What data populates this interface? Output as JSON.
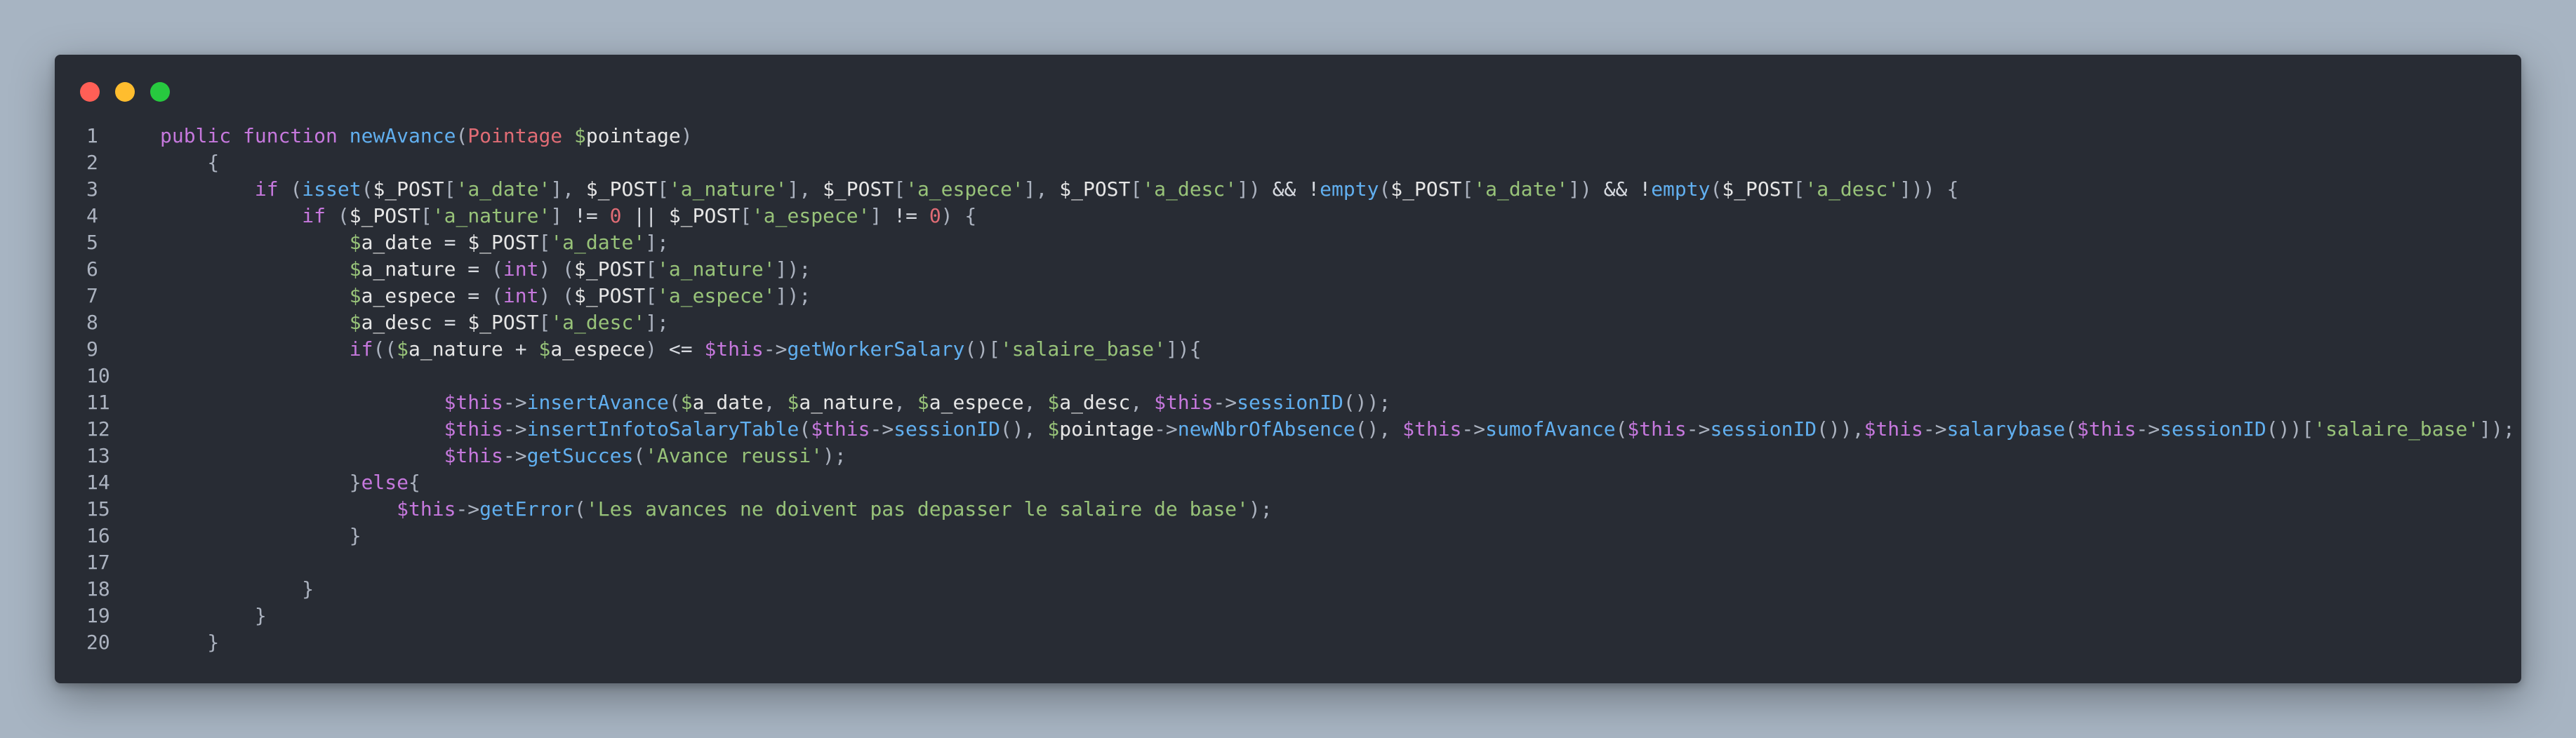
{
  "window": {
    "traffic_lights": [
      "close",
      "minimize",
      "maximize"
    ],
    "colors": {
      "background": "#a7b4c2",
      "window": "#282c34",
      "close": "#ff5f56",
      "minimize": "#ffbd2e",
      "maximize": "#27c93f"
    }
  },
  "code": {
    "language": "php",
    "lines": [
      {
        "n": "1",
        "tokens": [
          {
            "t": "kw",
            "v": "public function "
          },
          {
            "t": "fn",
            "v": "newAvance"
          },
          {
            "t": "punc",
            "v": "("
          },
          {
            "t": "cls",
            "v": "Pointage "
          },
          {
            "t": "dollar",
            "v": "$"
          },
          {
            "t": "var",
            "v": "pointage"
          },
          {
            "t": "punc",
            "v": ")"
          }
        ]
      },
      {
        "n": "2",
        "tokens": [
          {
            "t": "punc",
            "v": "    {"
          }
        ]
      },
      {
        "n": "3",
        "tokens": [
          {
            "t": "kw",
            "v": "        if "
          },
          {
            "t": "punc",
            "v": "("
          },
          {
            "t": "fn",
            "v": "isset"
          },
          {
            "t": "punc",
            "v": "("
          },
          {
            "t": "var",
            "v": "$_POST"
          },
          {
            "t": "punc",
            "v": "["
          },
          {
            "t": "str",
            "v": "'a_date'"
          },
          {
            "t": "punc",
            "v": "], "
          },
          {
            "t": "var",
            "v": "$_POST"
          },
          {
            "t": "punc",
            "v": "["
          },
          {
            "t": "str",
            "v": "'a_nature'"
          },
          {
            "t": "punc",
            "v": "], "
          },
          {
            "t": "var",
            "v": "$_POST"
          },
          {
            "t": "punc",
            "v": "["
          },
          {
            "t": "str",
            "v": "'a_espece'"
          },
          {
            "t": "punc",
            "v": "], "
          },
          {
            "t": "var",
            "v": "$_POST"
          },
          {
            "t": "punc",
            "v": "["
          },
          {
            "t": "str",
            "v": "'a_desc'"
          },
          {
            "t": "punc",
            "v": "]) "
          },
          {
            "t": "op",
            "v": "&& !"
          },
          {
            "t": "fn",
            "v": "empty"
          },
          {
            "t": "punc",
            "v": "("
          },
          {
            "t": "var",
            "v": "$_POST"
          },
          {
            "t": "punc",
            "v": "["
          },
          {
            "t": "str",
            "v": "'a_date'"
          },
          {
            "t": "punc",
            "v": "]) "
          },
          {
            "t": "op",
            "v": "&& !"
          },
          {
            "t": "fn",
            "v": "empty"
          },
          {
            "t": "punc",
            "v": "("
          },
          {
            "t": "var",
            "v": "$_POST"
          },
          {
            "t": "punc",
            "v": "["
          },
          {
            "t": "str",
            "v": "'a_desc'"
          },
          {
            "t": "punc",
            "v": "])) {"
          }
        ]
      },
      {
        "n": "4",
        "tokens": [
          {
            "t": "kw",
            "v": "            if "
          },
          {
            "t": "punc",
            "v": "("
          },
          {
            "t": "var",
            "v": "$_POST"
          },
          {
            "t": "punc",
            "v": "["
          },
          {
            "t": "str",
            "v": "'a_nature'"
          },
          {
            "t": "punc",
            "v": "] "
          },
          {
            "t": "op",
            "v": "!= "
          },
          {
            "t": "num",
            "v": "0"
          },
          {
            "t": "op",
            "v": " || "
          },
          {
            "t": "var",
            "v": "$_POST"
          },
          {
            "t": "punc",
            "v": "["
          },
          {
            "t": "str",
            "v": "'a_espece'"
          },
          {
            "t": "punc",
            "v": "] "
          },
          {
            "t": "op",
            "v": "!= "
          },
          {
            "t": "num",
            "v": "0"
          },
          {
            "t": "punc",
            "v": ") {"
          }
        ]
      },
      {
        "n": "5",
        "tokens": [
          {
            "t": "dollar",
            "v": "                $"
          },
          {
            "t": "var",
            "v": "a_date"
          },
          {
            "t": "op",
            "v": " = "
          },
          {
            "t": "var",
            "v": "$_POST"
          },
          {
            "t": "punc",
            "v": "["
          },
          {
            "t": "str",
            "v": "'a_date'"
          },
          {
            "t": "punc",
            "v": "];"
          }
        ]
      },
      {
        "n": "6",
        "tokens": [
          {
            "t": "dollar",
            "v": "                $"
          },
          {
            "t": "var",
            "v": "a_nature"
          },
          {
            "t": "op",
            "v": " = "
          },
          {
            "t": "punc",
            "v": "("
          },
          {
            "t": "kw",
            "v": "int"
          },
          {
            "t": "punc",
            "v": ") ("
          },
          {
            "t": "var",
            "v": "$_POST"
          },
          {
            "t": "punc",
            "v": "["
          },
          {
            "t": "str",
            "v": "'a_nature'"
          },
          {
            "t": "punc",
            "v": "]);"
          }
        ]
      },
      {
        "n": "7",
        "tokens": [
          {
            "t": "dollar",
            "v": "                $"
          },
          {
            "t": "var",
            "v": "a_espece"
          },
          {
            "t": "op",
            "v": " = "
          },
          {
            "t": "punc",
            "v": "("
          },
          {
            "t": "kw",
            "v": "int"
          },
          {
            "t": "punc",
            "v": ") ("
          },
          {
            "t": "var",
            "v": "$_POST"
          },
          {
            "t": "punc",
            "v": "["
          },
          {
            "t": "str",
            "v": "'a_espece'"
          },
          {
            "t": "punc",
            "v": "]);"
          }
        ]
      },
      {
        "n": "8",
        "tokens": [
          {
            "t": "dollar",
            "v": "                $"
          },
          {
            "t": "var",
            "v": "a_desc"
          },
          {
            "t": "op",
            "v": " = "
          },
          {
            "t": "var",
            "v": "$_POST"
          },
          {
            "t": "punc",
            "v": "["
          },
          {
            "t": "str",
            "v": "'a_desc'"
          },
          {
            "t": "punc",
            "v": "];"
          }
        ]
      },
      {
        "n": "9",
        "tokens": [
          {
            "t": "kw",
            "v": "                if"
          },
          {
            "t": "punc",
            "v": "(("
          },
          {
            "t": "dollar",
            "v": "$"
          },
          {
            "t": "var",
            "v": "a_nature"
          },
          {
            "t": "op",
            "v": " + "
          },
          {
            "t": "dollar",
            "v": "$"
          },
          {
            "t": "var",
            "v": "a_espece"
          },
          {
            "t": "punc",
            "v": ") "
          },
          {
            "t": "op",
            "v": "<= "
          },
          {
            "t": "this",
            "v": "$this"
          },
          {
            "t": "arrow",
            "v": "->"
          },
          {
            "t": "fn",
            "v": "getWorkerSalary"
          },
          {
            "t": "punc",
            "v": "()["
          },
          {
            "t": "str",
            "v": "'salaire_base'"
          },
          {
            "t": "punc",
            "v": "]){"
          }
        ]
      },
      {
        "n": "10",
        "tokens": []
      },
      {
        "n": "11",
        "tokens": [
          {
            "t": "this",
            "v": "                        $this"
          },
          {
            "t": "arrow",
            "v": "->"
          },
          {
            "t": "fn",
            "v": "insertAvance"
          },
          {
            "t": "punc",
            "v": "("
          },
          {
            "t": "dollar",
            "v": "$"
          },
          {
            "t": "var",
            "v": "a_date"
          },
          {
            "t": "punc",
            "v": ", "
          },
          {
            "t": "dollar",
            "v": "$"
          },
          {
            "t": "var",
            "v": "a_nature"
          },
          {
            "t": "punc",
            "v": ", "
          },
          {
            "t": "dollar",
            "v": "$"
          },
          {
            "t": "var",
            "v": "a_espece"
          },
          {
            "t": "punc",
            "v": ", "
          },
          {
            "t": "dollar",
            "v": "$"
          },
          {
            "t": "var",
            "v": "a_desc"
          },
          {
            "t": "punc",
            "v": ", "
          },
          {
            "t": "this",
            "v": "$this"
          },
          {
            "t": "arrow",
            "v": "->"
          },
          {
            "t": "fn",
            "v": "sessionID"
          },
          {
            "t": "punc",
            "v": "());"
          }
        ]
      },
      {
        "n": "12",
        "tokens": [
          {
            "t": "this",
            "v": "                        $this"
          },
          {
            "t": "arrow",
            "v": "->"
          },
          {
            "t": "fn",
            "v": "insertInfotoSalaryTable"
          },
          {
            "t": "punc",
            "v": "("
          },
          {
            "t": "this",
            "v": "$this"
          },
          {
            "t": "arrow",
            "v": "->"
          },
          {
            "t": "fn",
            "v": "sessionID"
          },
          {
            "t": "punc",
            "v": "(), "
          },
          {
            "t": "dollar",
            "v": "$"
          },
          {
            "t": "var",
            "v": "pointage"
          },
          {
            "t": "arrow",
            "v": "->"
          },
          {
            "t": "fn",
            "v": "newNbrOfAbsence"
          },
          {
            "t": "punc",
            "v": "(), "
          },
          {
            "t": "this",
            "v": "$this"
          },
          {
            "t": "arrow",
            "v": "->"
          },
          {
            "t": "fn",
            "v": "sumofAvance"
          },
          {
            "t": "punc",
            "v": "("
          },
          {
            "t": "this",
            "v": "$this"
          },
          {
            "t": "arrow",
            "v": "->"
          },
          {
            "t": "fn",
            "v": "sessionID"
          },
          {
            "t": "punc",
            "v": "()),"
          },
          {
            "t": "this",
            "v": "$this"
          },
          {
            "t": "arrow",
            "v": "->"
          },
          {
            "t": "fn",
            "v": "salarybase"
          },
          {
            "t": "punc",
            "v": "("
          },
          {
            "t": "this",
            "v": "$this"
          },
          {
            "t": "arrow",
            "v": "->"
          },
          {
            "t": "fn",
            "v": "sessionID"
          },
          {
            "t": "punc",
            "v": "())["
          },
          {
            "t": "str",
            "v": "'salaire_base'"
          },
          {
            "t": "punc",
            "v": "]);"
          }
        ]
      },
      {
        "n": "13",
        "tokens": [
          {
            "t": "this",
            "v": "                        $this"
          },
          {
            "t": "arrow",
            "v": "->"
          },
          {
            "t": "fn",
            "v": "getSucces"
          },
          {
            "t": "punc",
            "v": "("
          },
          {
            "t": "str",
            "v": "'Avance reussi'"
          },
          {
            "t": "punc",
            "v": ");"
          }
        ]
      },
      {
        "n": "14",
        "tokens": [
          {
            "t": "punc",
            "v": "                }"
          },
          {
            "t": "kw",
            "v": "else"
          },
          {
            "t": "punc",
            "v": "{"
          }
        ]
      },
      {
        "n": "15",
        "tokens": [
          {
            "t": "this",
            "v": "                    $this"
          },
          {
            "t": "arrow",
            "v": "->"
          },
          {
            "t": "fn",
            "v": "getError"
          },
          {
            "t": "punc",
            "v": "("
          },
          {
            "t": "str",
            "v": "'Les avances ne doivent pas depasser le salaire de base'"
          },
          {
            "t": "punc",
            "v": ");"
          }
        ]
      },
      {
        "n": "16",
        "tokens": [
          {
            "t": "punc",
            "v": "                }"
          }
        ]
      },
      {
        "n": "17",
        "tokens": []
      },
      {
        "n": "18",
        "tokens": [
          {
            "t": "punc",
            "v": "            }"
          }
        ]
      },
      {
        "n": "19",
        "tokens": [
          {
            "t": "punc",
            "v": "        }"
          }
        ]
      },
      {
        "n": "20",
        "tokens": [
          {
            "t": "punc",
            "v": "    }"
          }
        ]
      }
    ]
  }
}
